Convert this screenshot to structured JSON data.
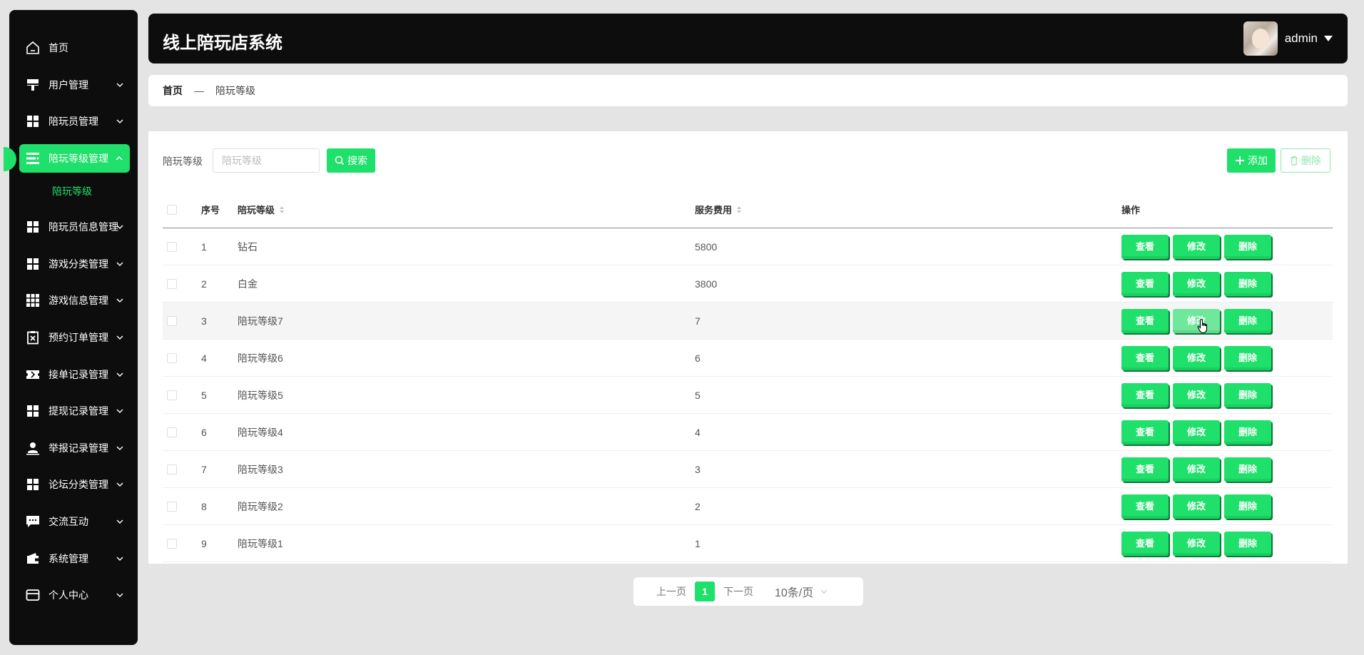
{
  "header": {
    "title": "线上陪玩店系统",
    "user_name": "admin"
  },
  "sidebar": {
    "items": [
      {
        "label": "首页",
        "icon": "home-icon"
      },
      {
        "label": "用户管理",
        "icon": "user-manage-icon"
      },
      {
        "label": "陪玩员管理",
        "icon": "grid-icon"
      },
      {
        "label": "陪玩等级管理",
        "icon": "list-icon",
        "active": true
      },
      {
        "label": "陪玩员信息管理",
        "icon": "grid-icon"
      },
      {
        "label": "游戏分类管理",
        "icon": "grid-icon"
      },
      {
        "label": "游戏信息管理",
        "icon": "apps-icon"
      },
      {
        "label": "预约订单管理",
        "icon": "clipboard-icon"
      },
      {
        "label": "接单记录管理",
        "icon": "ticket-icon"
      },
      {
        "label": "提现记录管理",
        "icon": "grid-icon"
      },
      {
        "label": "举报记录管理",
        "icon": "person-icon"
      },
      {
        "label": "论坛分类管理",
        "icon": "grid-icon"
      },
      {
        "label": "交流互动",
        "icon": "chat-icon"
      },
      {
        "label": "系统管理",
        "icon": "wallet-icon"
      },
      {
        "label": "个人中心",
        "icon": "card-icon"
      }
    ],
    "sub_item": "陪玩等级"
  },
  "breadcrumb": {
    "home": "首页",
    "separator": "—",
    "current": "陪玩等级"
  },
  "search": {
    "label": "陪玩等级",
    "placeholder": "陪玩等级",
    "button": "搜索"
  },
  "toolbar": {
    "add": "添加",
    "delete": "删除"
  },
  "table": {
    "columns": [
      "序号",
      "陪玩等级",
      "服务费用",
      "操作"
    ],
    "rows": [
      {
        "idx": "1",
        "level": "钻石",
        "fee": "5800"
      },
      {
        "idx": "2",
        "level": "白金",
        "fee": "3800"
      },
      {
        "idx": "3",
        "level": "陪玩等级7",
        "fee": "7"
      },
      {
        "idx": "4",
        "level": "陪玩等级6",
        "fee": "6"
      },
      {
        "idx": "5",
        "level": "陪玩等级5",
        "fee": "5"
      },
      {
        "idx": "6",
        "level": "陪玩等级4",
        "fee": "4"
      },
      {
        "idx": "7",
        "level": "陪玩等级3",
        "fee": "3"
      },
      {
        "idx": "8",
        "level": "陪玩等级2",
        "fee": "2"
      },
      {
        "idx": "9",
        "level": "陪玩等级1",
        "fee": "1"
      }
    ],
    "actions": {
      "view": "查看",
      "edit": "修改",
      "delete": "删除"
    }
  },
  "pagination": {
    "prev": "上一页",
    "page": "1",
    "next": "下一页",
    "size": "10条/页"
  },
  "colors": {
    "accent": "#1fe06a",
    "sidebar_bg": "#0d0d0d"
  }
}
